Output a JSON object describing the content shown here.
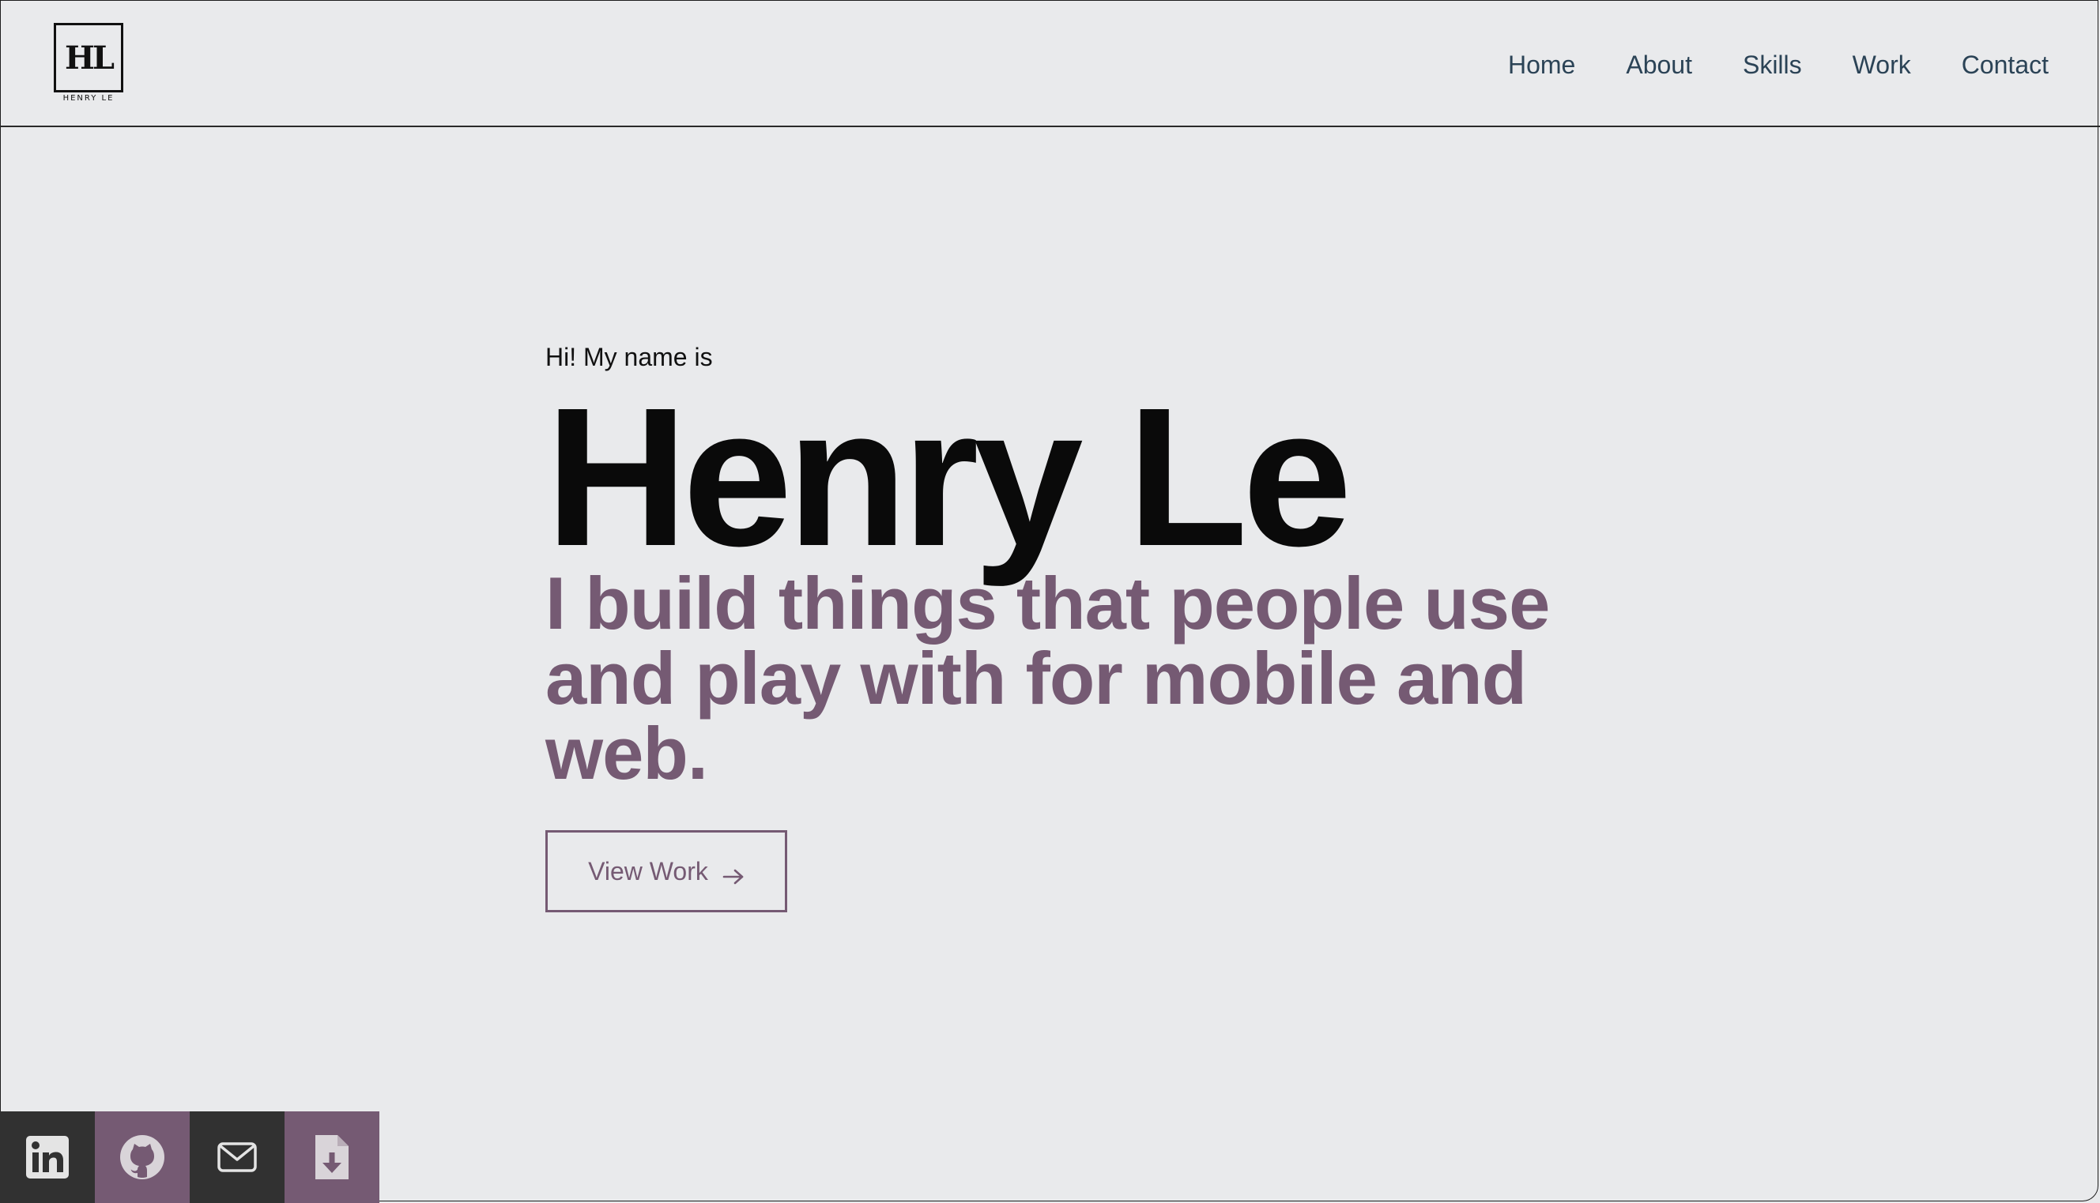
{
  "header": {
    "logo_mark": "HL",
    "logo_subtitle": "HENRY LE",
    "nav": [
      {
        "label": "Home"
      },
      {
        "label": "About"
      },
      {
        "label": "Skills"
      },
      {
        "label": "Work"
      },
      {
        "label": "Contact"
      }
    ]
  },
  "hero": {
    "greeting": "Hi! My name is",
    "name": "Henry Le",
    "tagline": "I build things that people use and play with for mobile and web.",
    "cta_label": "View Work",
    "cta_icon": "arrow-right-icon"
  },
  "socials": [
    {
      "icon": "linkedin-icon",
      "color": "#313131"
    },
    {
      "icon": "github-icon",
      "color": "#755a73"
    },
    {
      "icon": "mail-icon",
      "color": "#313131"
    },
    {
      "icon": "file-download-icon",
      "color": "#755a73"
    }
  ],
  "colors": {
    "background": "#e9eaec",
    "accent": "#755a73",
    "nav_text": "#2b4356",
    "dark": "#313131"
  }
}
